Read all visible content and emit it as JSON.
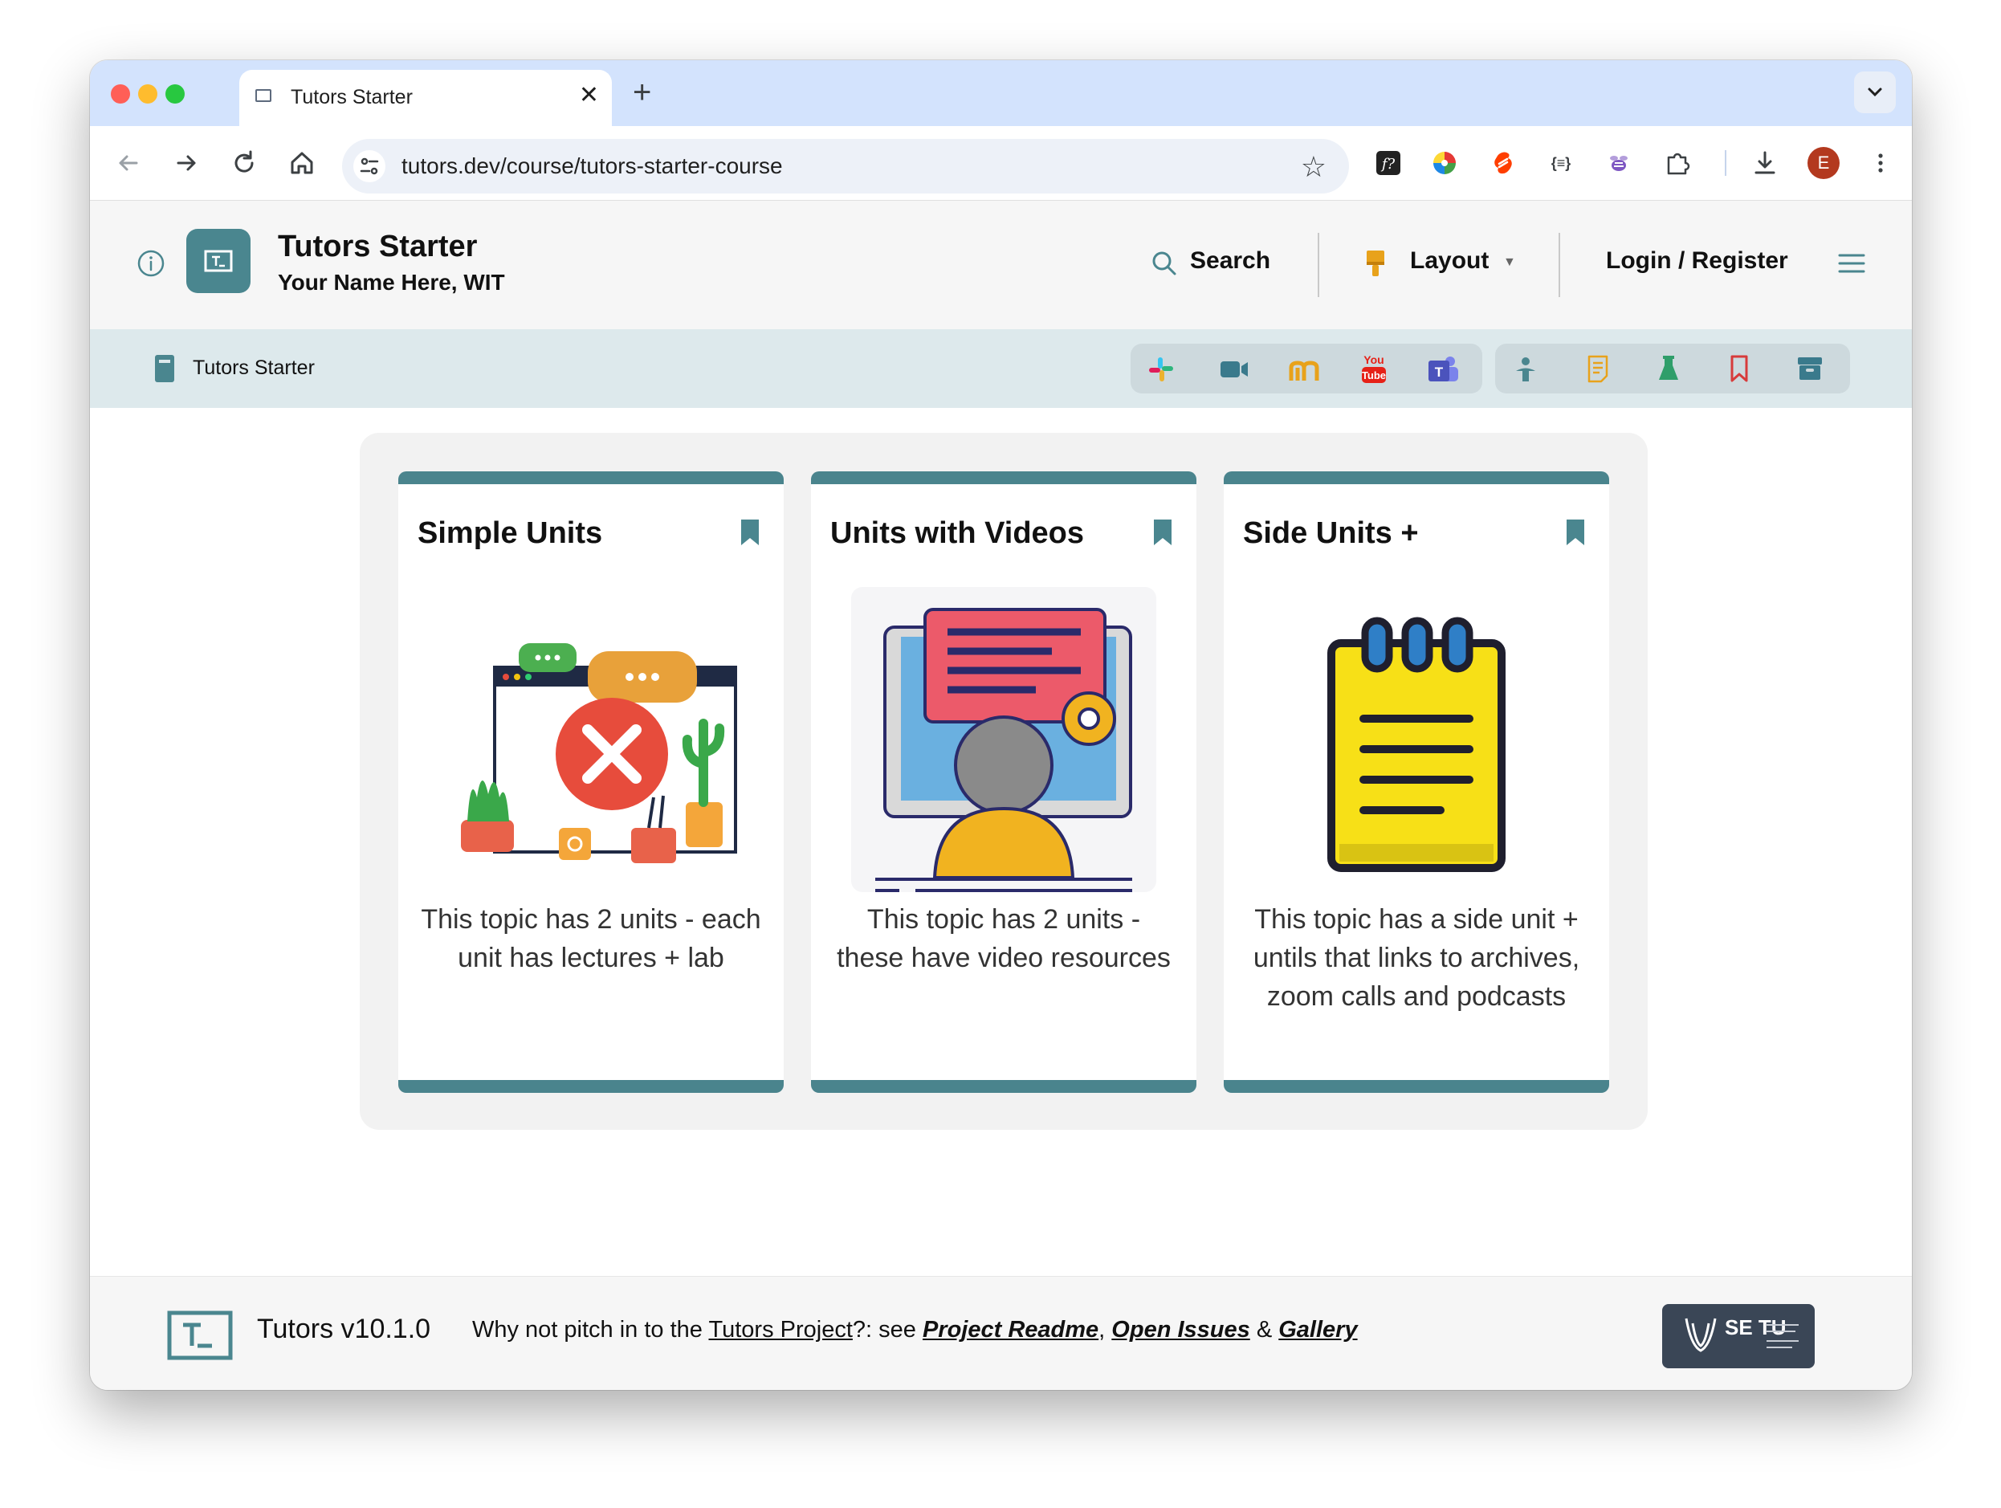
{
  "browser": {
    "tab_title": "Tutors Starter",
    "tab_close": "✕",
    "new_tab": "+",
    "url": "tutors.dev/course/tutors-starter-course",
    "profile_initial": "E",
    "extensions": [
      "fx-icon",
      "color-wheel-icon",
      "svelte-icon",
      "json-braces-icon",
      "bee-icon",
      "puzzle-icon"
    ]
  },
  "header": {
    "title": "Tutors Starter",
    "subtitle": "Your Name Here, WIT",
    "search_label": "Search",
    "layout_label": "Layout",
    "login_label": "Login / Register"
  },
  "coursebar": {
    "breadcrumb_label": "Tutors Starter",
    "companions": [
      "slack-icon",
      "zoom-icon",
      "moodle-icon",
      "youtube-icon",
      "teams-icon"
    ],
    "tools": [
      "person-icon",
      "notes-icon",
      "lab-icon",
      "bookmark-icon",
      "archive-icon"
    ]
  },
  "cards": [
    {
      "title": "Simple Units",
      "description": "This topic has 2 units - each unit has lectures + lab"
    },
    {
      "title": "Units with Videos",
      "description": "This topic has 2 units - these have video resources"
    },
    {
      "title": "Side Units +",
      "description": "This topic has a side unit + untils that links to archives, zoom calls and podcasts"
    }
  ],
  "footer": {
    "version": "Tutors v10.1.0",
    "pitch_prefix": "Why not pitch in to the ",
    "project_link": "Tutors Project",
    "pitch_middle": "?: see ",
    "readme_link": "Project Readme",
    "comma": ", ",
    "issues_link": "Open Issues",
    "amp": " & ",
    "gallery_link": "Gallery",
    "setu_logo_text": "SE TU"
  },
  "colors": {
    "brand_teal": "#4a868f",
    "coursebar_bg": "#dde9ec",
    "tab_strip": "#d3e3fd"
  }
}
